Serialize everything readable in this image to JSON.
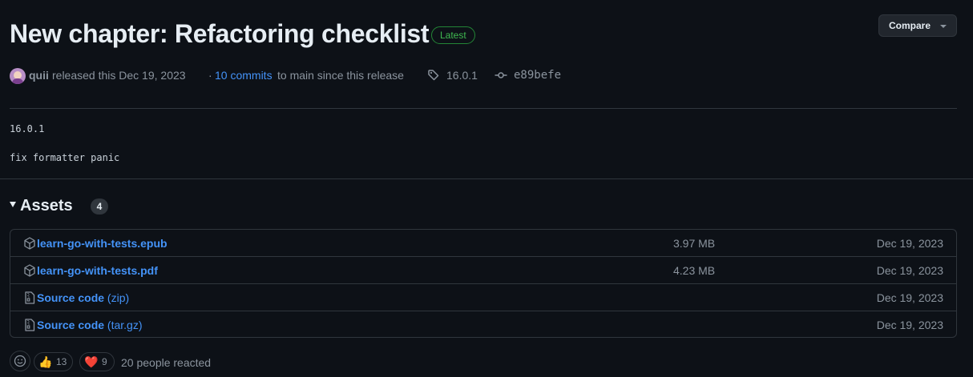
{
  "release": {
    "title": "New chapter: Refactoring checklist",
    "latest_label": "Latest",
    "compare_label": "Compare",
    "author": "quii",
    "released_text": "released this Dec 19, 2023",
    "dot": "·",
    "commits_link": "10 commits",
    "commits_rest": "to main since this release",
    "tag": "16.0.1",
    "commit": "e89befe",
    "body_lines": [
      "16.0.1",
      "fix formatter panic"
    ]
  },
  "assets": {
    "heading": "Assets",
    "count": "4",
    "rows": [
      {
        "icon": "package-icon",
        "name": "learn-go-with-tests.epub",
        "sub": "",
        "size": "3.97 MB",
        "date": "Dec 19, 2023"
      },
      {
        "icon": "package-icon",
        "name": "learn-go-with-tests.pdf",
        "sub": "",
        "size": "4.23 MB",
        "date": "Dec 19, 2023"
      },
      {
        "icon": "file-zip-icon",
        "name": "Source code",
        "sub": "(zip)",
        "size": "",
        "date": "Dec 19, 2023"
      },
      {
        "icon": "file-zip-icon",
        "name": "Source code",
        "sub": "(tar.gz)",
        "size": "",
        "date": "Dec 19, 2023"
      }
    ]
  },
  "reactions": {
    "items": [
      {
        "emoji": "👍",
        "count": "13",
        "icon": "thumbs-up-icon"
      },
      {
        "emoji": "❤️",
        "count": "9",
        "icon": "heart-icon"
      }
    ],
    "summary": "20 people reacted"
  },
  "colors": {
    "background": "#0d1117",
    "link": "#4493f8",
    "muted": "#8b949e",
    "latest_green": "#3fb950",
    "border": "#30363d"
  }
}
